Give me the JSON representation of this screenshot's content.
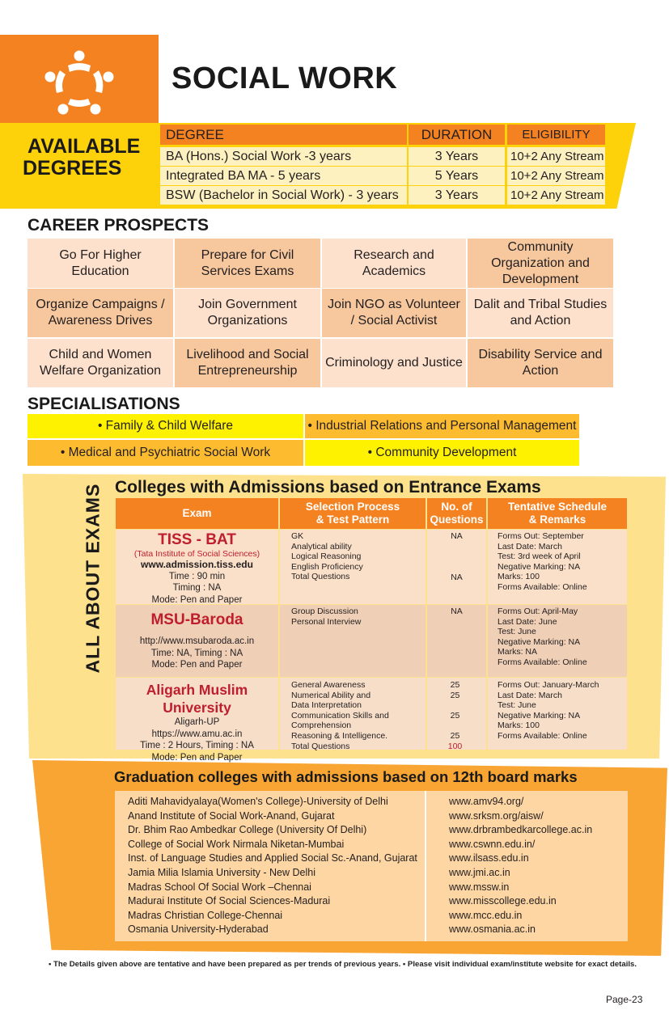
{
  "header": {
    "title": "SOCIAL WORK",
    "logo_icon": "people-circle-logo"
  },
  "degrees": {
    "label_line1": "AVAILABLE",
    "label_line2": "DEGREES",
    "headers": [
      "DEGREE",
      "DURATION",
      "ELIGIBILITY"
    ],
    "rows": [
      [
        "BA (Hons.) Social Work -3 years",
        "3 Years",
        "10+2 Any Stream"
      ],
      [
        "Integrated BA MA - 5 years",
        "5 Years",
        "10+2 Any Stream"
      ],
      [
        "BSW (Bachelor in Social Work) - 3 years",
        "3 Years",
        "10+2 Any Stream"
      ]
    ]
  },
  "career": {
    "title": "CAREER PROSPECTS",
    "items": [
      "Go For Higher Education",
      "Prepare for Civil Services Exams",
      "Research and Academics",
      "Community Organization and Development",
      "Organize Campaigns / Awareness Drives",
      "Join Government Organizations",
      "Join NGO as Volunteer / Social Activist",
      "Dalit and Tribal Studies and Action",
      "Child and Women Welfare Organization",
      "Livelihood and Social Entrepreneurship",
      "Criminology and Justice",
      "Disability Service and Action"
    ]
  },
  "specialisations": {
    "title": "SPECIALISATIONS",
    "items": [
      "• Family & Child Welfare",
      "• Industrial Relations and Personal Management",
      "• Medical and Psychiatric Social Work",
      "• Community Development"
    ]
  },
  "exams": {
    "side_label": "ALL ABOUT EXAMS",
    "heading": "Colleges with Admissions based on Entrance Exams",
    "headers": {
      "exam": "Exam",
      "process_1": "Selection Process",
      "process_2": "& Test Pattern",
      "questions_1": "No. of",
      "questions_2": "Questions",
      "schedule_1": "Tentative Schedule",
      "schedule_2": "& Remarks"
    },
    "rows": [
      {
        "name": "TISS - BAT",
        "subtitle": "(Tata Institute of Social Sciences)",
        "website": "www.admission.tiss.edu",
        "details": [
          "Time : 90 min",
          "Timing : NA",
          "Mode: Pen and Paper"
        ],
        "process": [
          "GK",
          "Analytical ability",
          "Logical Reasoning",
          "English Proficiency",
          "Total Questions"
        ],
        "questions": [
          "NA",
          "",
          "",
          "",
          "NA"
        ],
        "schedule": [
          "Forms Out: September",
          "Last Date: March",
          "Test: 3rd week of April",
          "Negative Marking: NA",
          "Marks: 100",
          "Forms Available: Online"
        ]
      },
      {
        "name": "MSU-Baroda",
        "subtitle": "",
        "website": "http://www.msubaroda.ac.in",
        "details": [
          "Time: NA, Timing : NA",
          "Mode: Pen and Paper"
        ],
        "process": [
          "Group Discussion",
          "Personal Interview"
        ],
        "questions": [
          "NA"
        ],
        "schedule": [
          "Forms Out: April-May",
          "Last Date: June",
          "Test: June",
          "Negative Marking: NA",
          "Marks: NA",
          "Forms Available: Online"
        ]
      },
      {
        "name": "Aligarh Muslim University",
        "subtitle": "",
        "location": "Aligarh-UP",
        "website": "https://www.amu.ac.in",
        "details": [
          "Time : 2 Hours, Timing : NA",
          "Mode: Pen and Paper"
        ],
        "process": [
          "General Awareness",
          "Numerical Ability and",
          "Data Interpretation",
          "Communication Skills and",
          "Comprehension",
          "Reasoning & Intelligence.",
          "Total Questions"
        ],
        "questions": [
          "25",
          "25",
          "",
          "25",
          "",
          "25",
          "100"
        ],
        "schedule": [
          "Forms Out: January-March",
          "Last Date: March",
          "Test: June",
          "Negative Marking:  NA",
          "Marks: 100",
          "Forms Available: Online"
        ]
      }
    ]
  },
  "graduation": {
    "heading": "Graduation colleges with admissions based on 12th board marks",
    "colleges": [
      "Aditi Mahavidyalaya(Women's College)-University of Delhi",
      "Anand Institute of Social Work-Anand, Gujarat",
      "Dr. Bhim Rao Ambedkar College (University Of Delhi)",
      "College of Social Work Nirmala Niketan-Mumbai",
      "Inst. of Language Studies and Applied Social Sc.-Anand, Gujarat",
      "Jamia Milia Islamia University - New Delhi",
      "Madras School Of Social Work –Chennai",
      "Madurai Institute Of Social Sciences-Madurai",
      "Madras Christian College-Chennai",
      "Osmania University-Hyderabad"
    ],
    "websites": [
      "www.amv94.org/",
      "www.srksm.org/aisw/",
      "www.drbrambedkarcollege.ac.in",
      "www.cswnn.edu.in/",
      "www.ilsass.edu.in",
      "www.jmi.ac.in",
      "www.mssw.in",
      "www.misscollege.edu.in",
      "www.mcc.edu.in",
      "www.osmania.ac.in"
    ]
  },
  "footnote": "• The Details given above are tentative and have been prepared as per trends of previous years. • Please visit individual exam/institute website for exact details.",
  "page_number": "Page-23",
  "colors": {
    "orange": "#f58220",
    "yellow": "#fdd20a",
    "career_light": "#fde1cc",
    "career_dark": "#f7c89e",
    "exam_name_red": "#be1e2d"
  }
}
